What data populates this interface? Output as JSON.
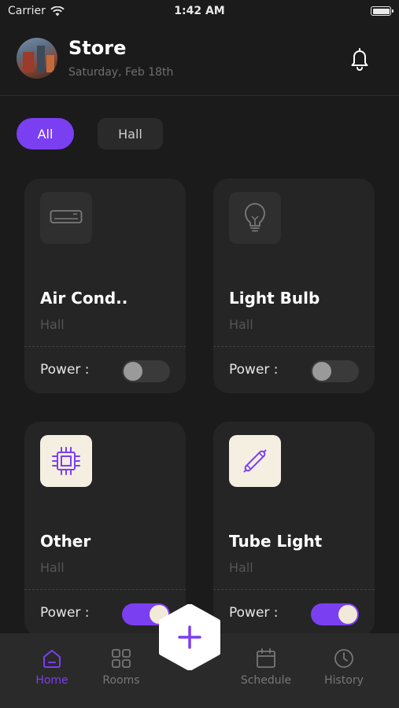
{
  "status_bar": {
    "carrier": "Carrier",
    "time": "1:42 AM"
  },
  "header": {
    "title": "Store",
    "date": "Saturday, Feb 18th"
  },
  "filters": [
    {
      "label": "All",
      "active": true
    },
    {
      "label": "Hall",
      "active": false
    }
  ],
  "devices": [
    {
      "name": "Air Cond..",
      "room": "Hall",
      "power_label": "Power :",
      "power_on": false,
      "icon": "air-conditioner-icon"
    },
    {
      "name": "Light Bulb",
      "room": "Hall",
      "power_label": "Power :",
      "power_on": false,
      "icon": "light-bulb-icon"
    },
    {
      "name": "Other",
      "room": "Hall",
      "power_label": "Power :",
      "power_on": true,
      "icon": "chip-icon"
    },
    {
      "name": "Tube Light",
      "room": "Hall",
      "power_label": "Power :",
      "power_on": true,
      "icon": "tube-light-icon"
    }
  ],
  "nav": {
    "home": "Home",
    "rooms": "Rooms",
    "schedule": "Schedule",
    "history": "History"
  },
  "colors": {
    "accent": "#7b3ff2",
    "background": "#1b1b1b",
    "card": "#252525",
    "icon_on_bg": "#f5efe2"
  }
}
